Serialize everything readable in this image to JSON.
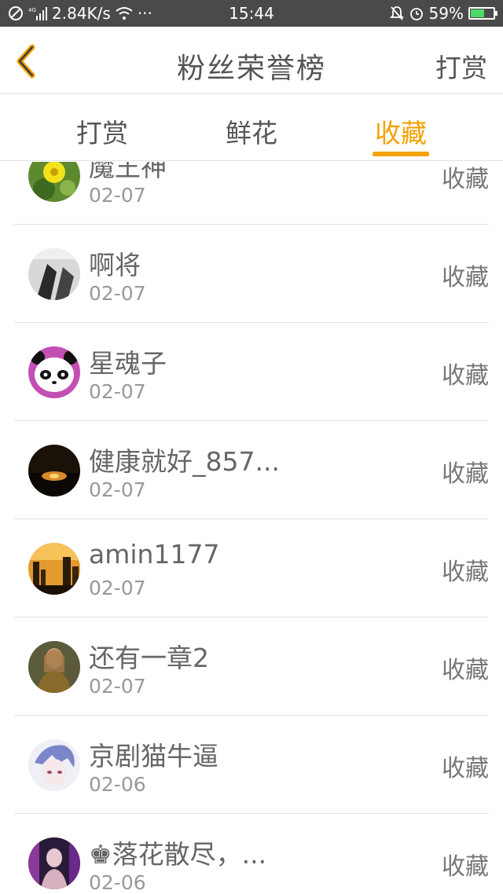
{
  "status_bar": {
    "speed": "2.84K/s",
    "dots": "···",
    "time": "15:44",
    "battery": "59%",
    "battery_level": 0.59
  },
  "header": {
    "title": "粉丝荣誉榜",
    "action": "打赏"
  },
  "tabs": [
    {
      "label": "打赏",
      "active": false
    },
    {
      "label": "鲜花",
      "active": false
    },
    {
      "label": "收藏",
      "active": true
    }
  ],
  "colors": {
    "accent": "#f5a100",
    "text": "#666666"
  },
  "items": [
    {
      "name": "魔王神",
      "date": "02-07",
      "action": "收藏"
    },
    {
      "name": "啊将",
      "date": "02-07",
      "action": "收藏"
    },
    {
      "name": "星魂子",
      "date": "02-07",
      "action": "收藏"
    },
    {
      "name": "健康就好_857...",
      "date": "02-07",
      "action": "收藏"
    },
    {
      "name": "amin1177",
      "date": "02-07",
      "action": "收藏"
    },
    {
      "name": "还有一章2",
      "date": "02-07",
      "action": "收藏"
    },
    {
      "name": "京剧猫牛逼",
      "date": "02-06",
      "action": "收藏"
    },
    {
      "name": "♚落花散尽，...",
      "date": "02-06",
      "action": "收藏"
    }
  ]
}
